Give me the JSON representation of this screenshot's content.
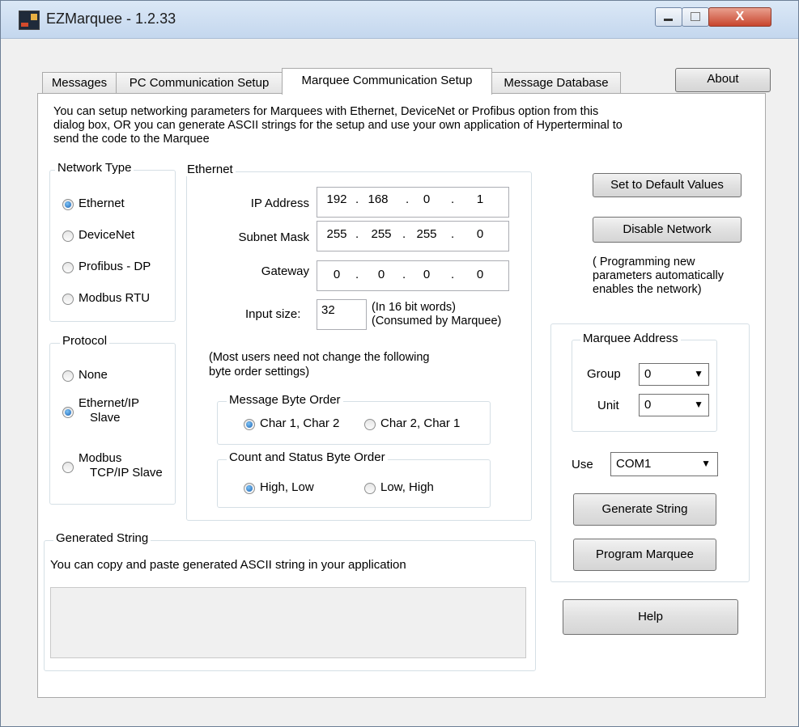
{
  "window": {
    "title": "EZMarquee - 1.2.33",
    "min_label": "",
    "max_label": "",
    "close_label": "X"
  },
  "tabs": [
    "Messages",
    "PC Communication Setup",
    "Marquee Communication Setup",
    "Message Database"
  ],
  "about_label": "About",
  "intro": [
    "You can setup networking parameters for Marquees with Ethernet, DeviceNet or Profibus option from this",
    "dialog box, OR you can generate ASCII strings for the setup and use your own application of Hyperterminal to",
    "send the code to the Marquee"
  ],
  "network_type": {
    "title": "Network Type",
    "options": [
      "Ethernet",
      "DeviceNet",
      "Profibus - DP",
      "Modbus RTU"
    ],
    "selected": "Ethernet"
  },
  "protocol": {
    "title": "Protocol",
    "none": "None",
    "ethip_1": "Ethernet/IP",
    "ethip_2": "Slave",
    "modbus_1": "Modbus",
    "modbus_2": "TCP/IP Slave",
    "selected": "Ethernet/IP Slave"
  },
  "ethernet": {
    "title": "Ethernet",
    "ip_label": "IP Address",
    "ip": [
      "192",
      "168",
      "0",
      "1"
    ],
    "subnet_label": "Subnet Mask",
    "subnet": [
      "255",
      "255",
      "255",
      "0"
    ],
    "gateway_label": "Gateway",
    "gateway": [
      "0",
      "0",
      "0",
      "0"
    ],
    "dot": ".",
    "input_size_label": "Input size:",
    "input_size": "32",
    "input_note_1": "(In 16 bit words)",
    "input_note_2": "(Consumed by Marquee)",
    "note_1": "(Most users need not change the following",
    "note_2": "byte order settings)"
  },
  "message_byte_order": {
    "title": "Message Byte Order",
    "opt1": "Char 1, Char 2",
    "opt2": "Char 2, Char 1",
    "selected": "Char 1, Char 2"
  },
  "count_status_order": {
    "title": "Count and Status Byte Order",
    "opt1": "High, Low",
    "opt2": "Low, High",
    "selected": "High, Low"
  },
  "right": {
    "default_btn": "Set to Default Values",
    "disable_btn": "Disable Network",
    "note": [
      "( Programming new",
      "parameters automatically",
      "enables the network)"
    ],
    "address_title": "Marquee Address",
    "group_label": "Group",
    "group_value": "0",
    "unit_label": "Unit",
    "unit_value": "0",
    "use_label": "Use",
    "com_value": "COM1",
    "generate_btn": "Generate String",
    "program_btn": "Program Marquee",
    "help_btn": "Help"
  },
  "generated": {
    "title": "Generated String",
    "desc": "You can copy and paste generated ASCII string in your application",
    "value": ""
  },
  "icons": {
    "app": "ezmarquee-app-icon",
    "dropdown": "chevron-down-icon"
  }
}
